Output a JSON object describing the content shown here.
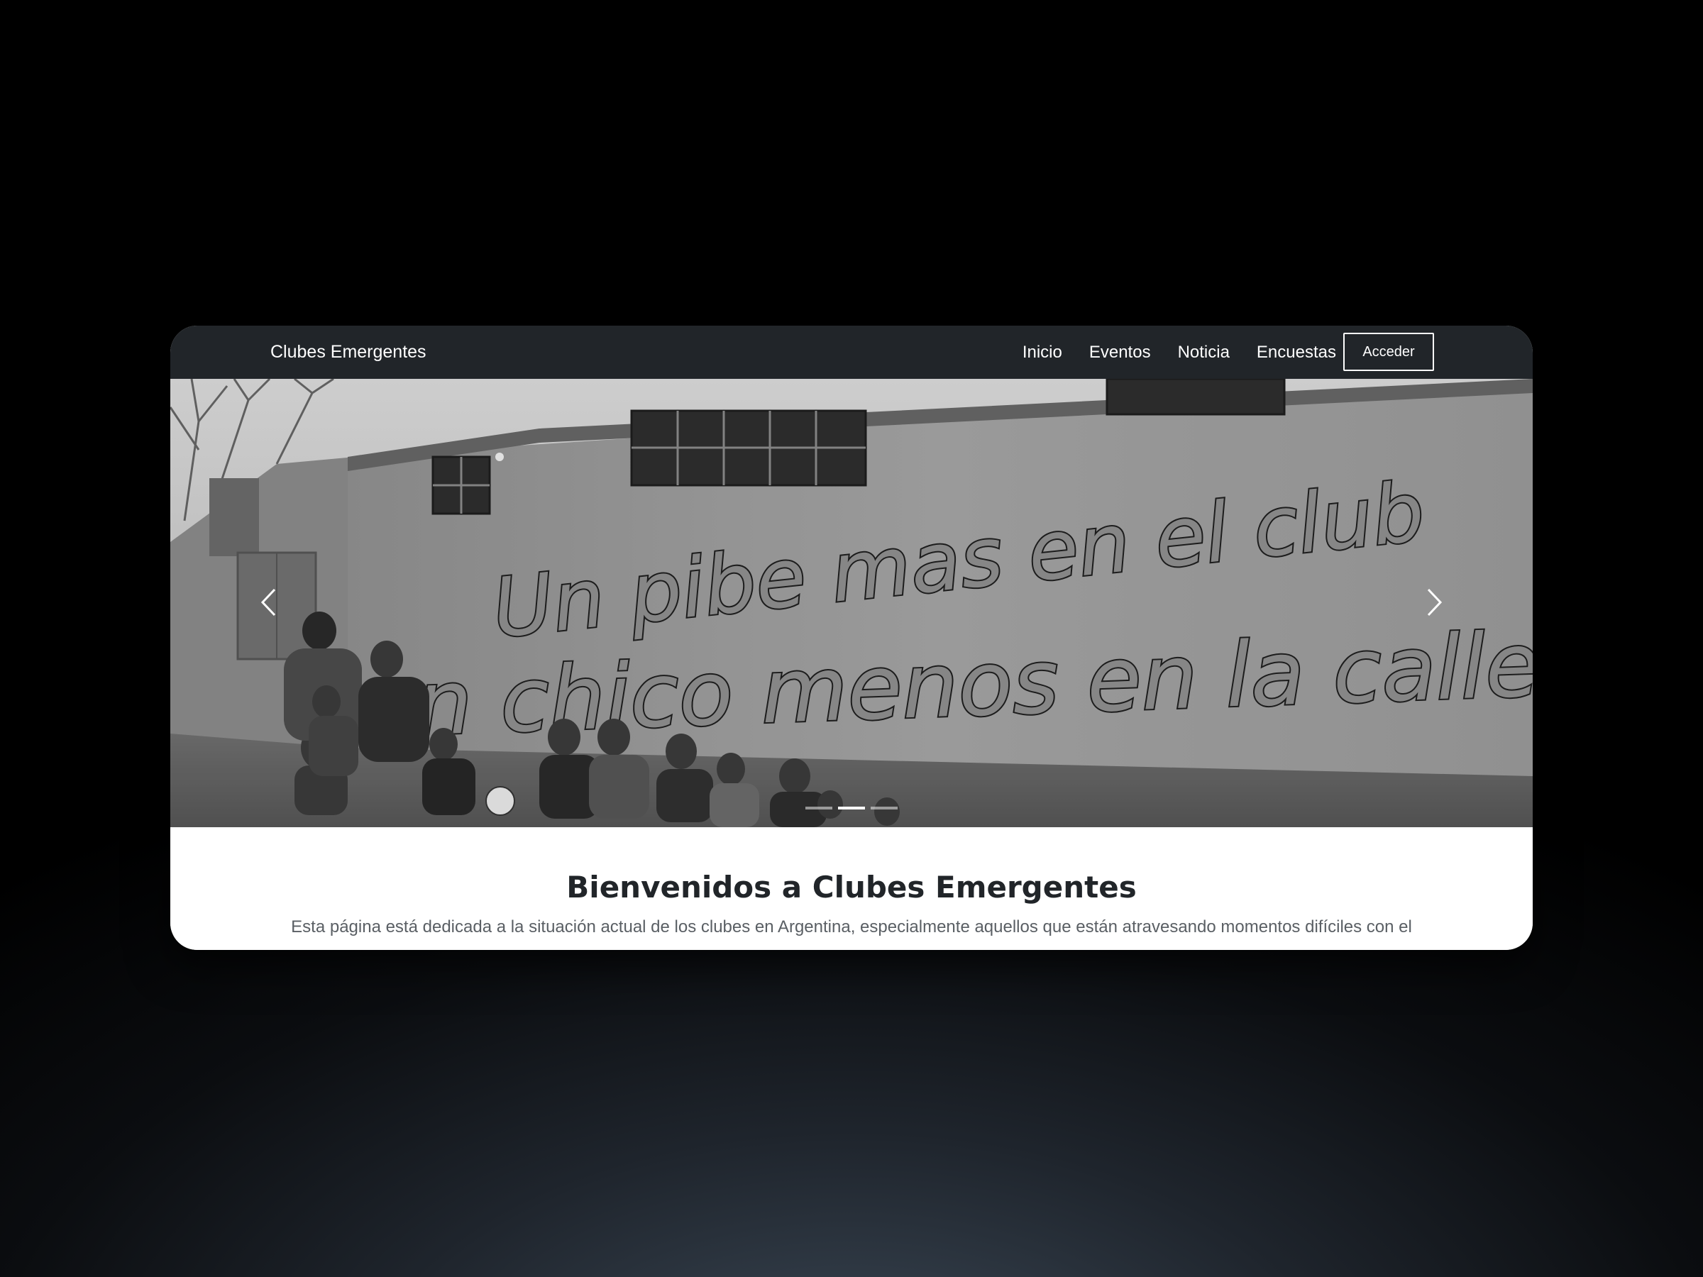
{
  "navbar": {
    "brand": "Clubes Emergentes",
    "links": [
      "Inicio",
      "Eventos",
      "Noticia",
      "Encuestas"
    ],
    "login_label": "Acceder"
  },
  "carousel": {
    "mural_line1": "Un pibe mas en el club",
    "mural_line2": "un chico menos en la calle",
    "prev_icon": "chevron-left-icon",
    "next_icon": "chevron-right-icon",
    "slide_count": 3,
    "active_slide": 2
  },
  "welcome": {
    "title": "Bienvenidos a Clubes Emergentes",
    "text": "Esta página está dedicada a la situación actual de los clubes en Argentina, especialmente aquellos que están atravesando momentos difíciles con el"
  },
  "colors": {
    "navbar_bg": "#212529",
    "page_bg": "#000000",
    "title_color": "#212529",
    "text_color": "#5a5f64"
  }
}
